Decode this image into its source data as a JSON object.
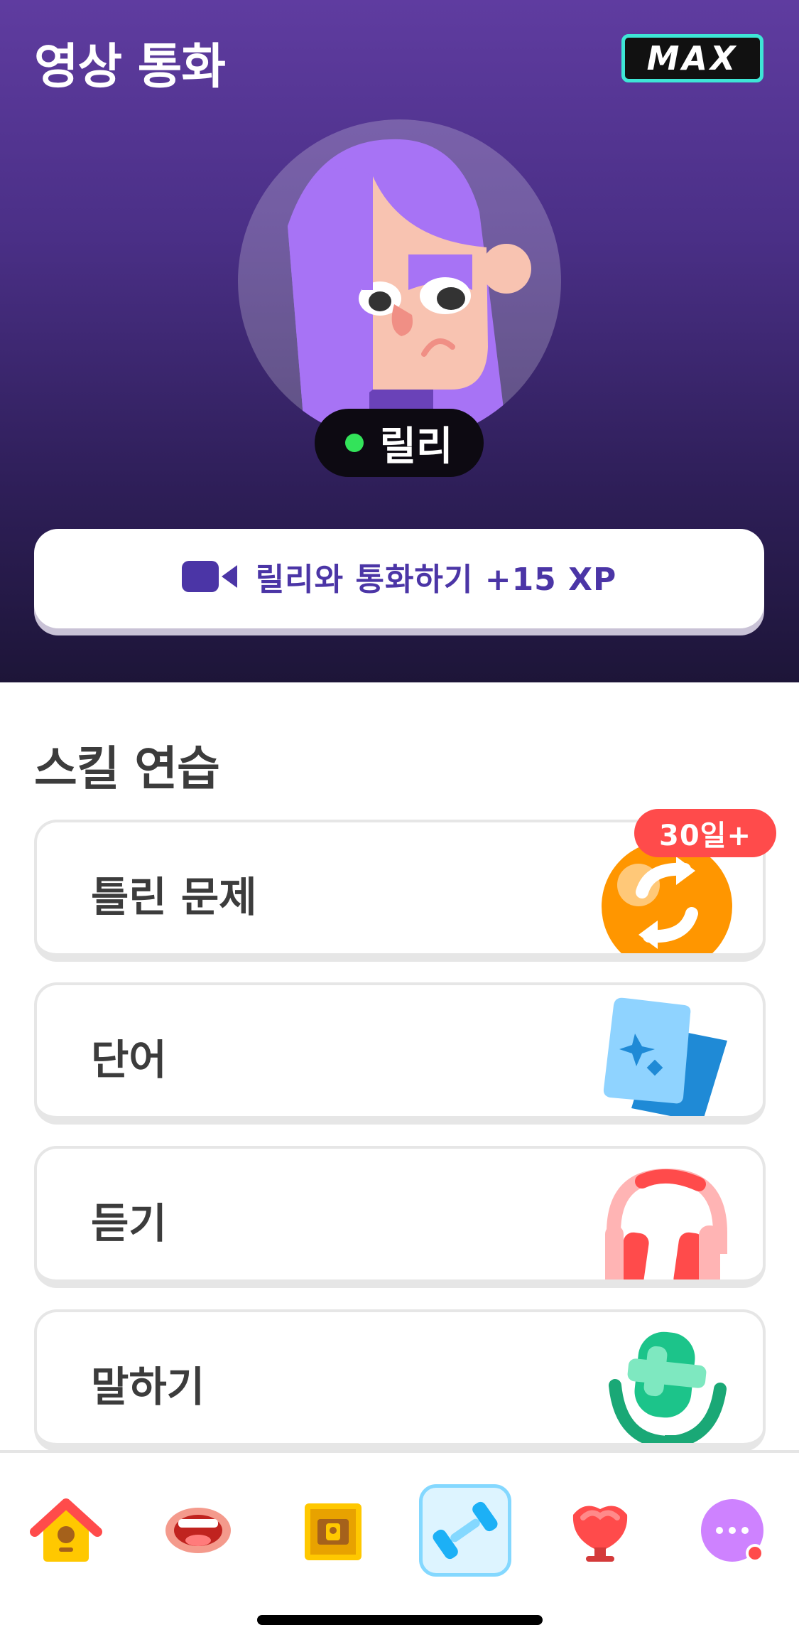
{
  "header": {
    "title": "영상 통화",
    "badge": "MAX"
  },
  "character": {
    "name": "릴리",
    "status": "online",
    "status_color": "#33e35a"
  },
  "call_button": {
    "label": "릴리와 통화하기 +15 XP",
    "icon": "video-camera-icon"
  },
  "skills": {
    "title": "스킬 연습",
    "items": [
      {
        "label": "틀린 문제",
        "icon": "refresh-arrows-icon",
        "badge": "30일+"
      },
      {
        "label": "단어",
        "icon": "flashcards-icon"
      },
      {
        "label": "듣기",
        "icon": "headphones-icon"
      },
      {
        "label": "말하기",
        "icon": "microphone-icon"
      }
    ]
  },
  "tab_bar": {
    "items": [
      {
        "name": "home",
        "icon": "birdhouse-icon",
        "active": false
      },
      {
        "name": "speak",
        "icon": "mouth-icon",
        "active": false
      },
      {
        "name": "treasure",
        "icon": "chest-icon",
        "active": false
      },
      {
        "name": "practice",
        "icon": "dumbbell-icon",
        "active": true
      },
      {
        "name": "leaderboard",
        "icon": "shield-trophy-icon",
        "active": false
      },
      {
        "name": "more",
        "icon": "more-icon",
        "active": false,
        "notification": true
      }
    ]
  },
  "colors": {
    "accent": "#4b35a6",
    "badge_red": "#ff4b4b",
    "max_border": "#3ee6d6",
    "active_tab_bg": "#ddf4ff"
  }
}
